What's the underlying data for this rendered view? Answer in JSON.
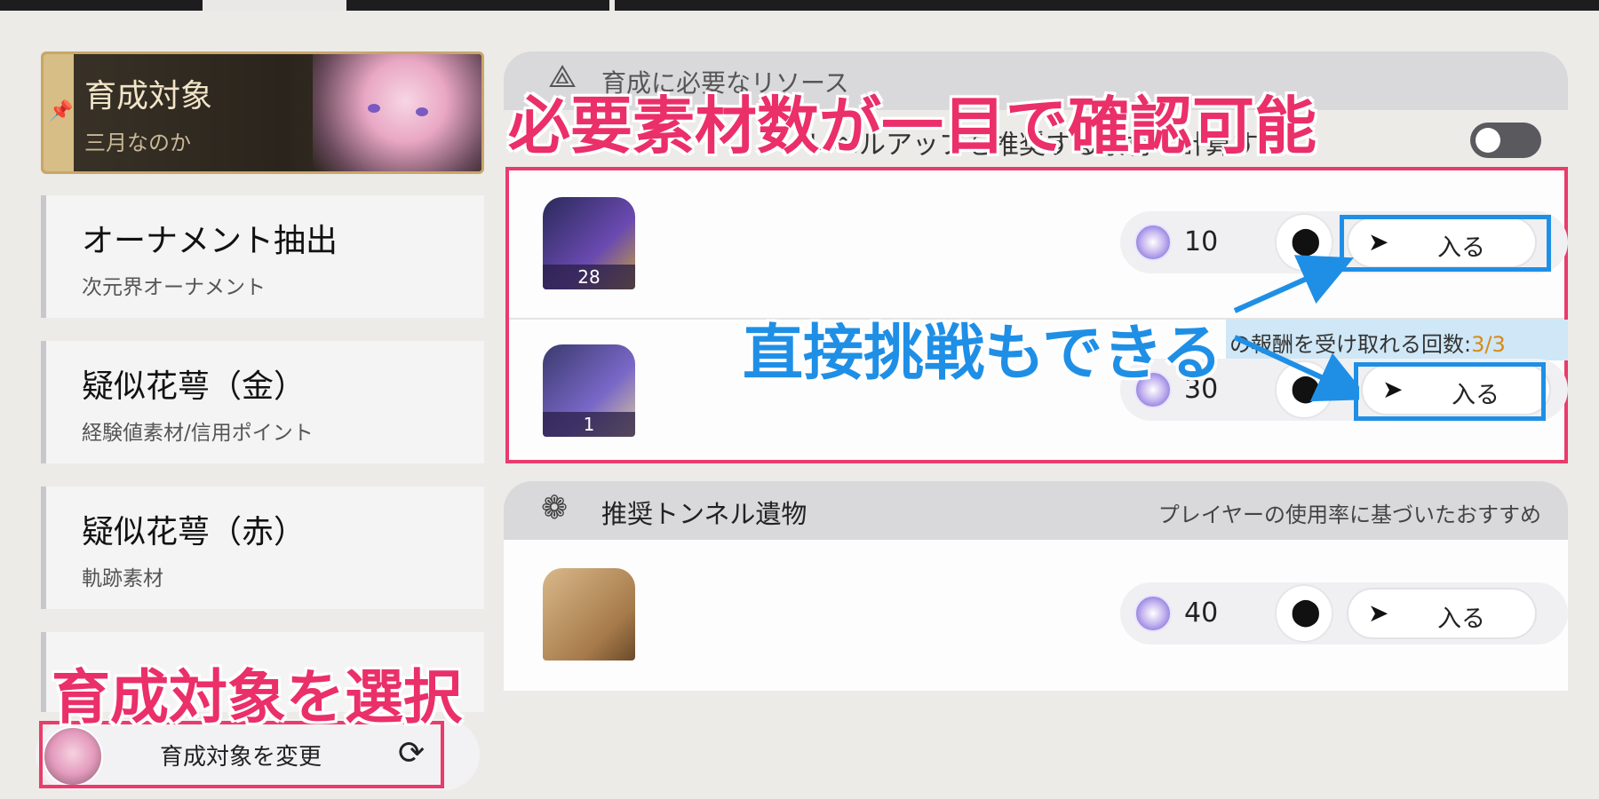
{
  "annotations": {
    "materials_callout": "必要素材数が一目で確認可能",
    "challenge_callout": "直接挑戦もできる",
    "select_callout": "育成対象を選択"
  },
  "sidebar": {
    "target_title": "育成対象",
    "target_name": "三月なのか",
    "items": [
      {
        "name": "オーナメント抽出",
        "sub": "次元界オーナメント"
      },
      {
        "name": "疑似花萼（金）",
        "sub": "経験値素材/信用ポイント"
      },
      {
        "name": "疑似花萼（赤）",
        "sub": "軌跡素材"
      }
    ],
    "change_button": "育成対象を変更"
  },
  "resources": {
    "header": "育成に必要なリソース",
    "toggle_label": "レベルアップを推奨する素材",
    "calc_label": "計算する",
    "rows": [
      {
        "icon_count": "28",
        "stamina": "10",
        "enter": "入る"
      },
      {
        "icon_count": "1",
        "stamina": "30",
        "enter": "入る"
      }
    ],
    "reward_text": "の報酬を受け取れる回数:",
    "reward_count": "3/3"
  },
  "tunnel": {
    "header": "推奨トンネル遺物",
    "note": "プレイヤーの使用率に基づいたおすすめ",
    "stamina": "40",
    "enter": "入る"
  },
  "colors": {
    "annotation_pink": "#ea2f69",
    "annotation_blue": "#1f8fe6",
    "gold": "#caa667"
  }
}
